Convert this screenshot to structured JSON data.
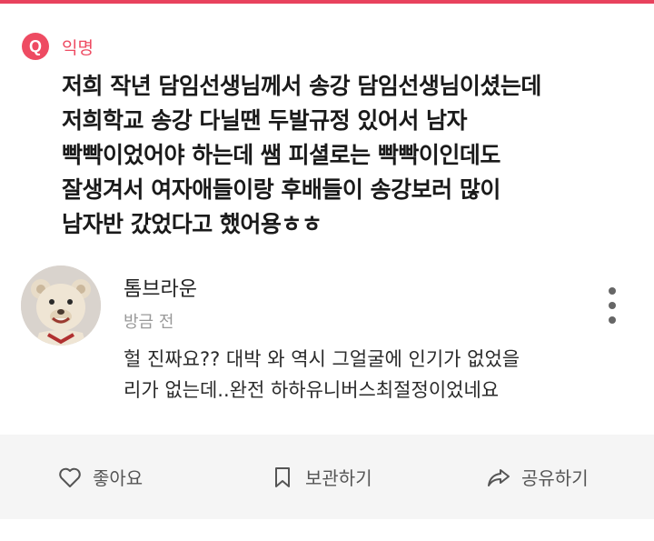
{
  "post": {
    "badge_letter": "Q",
    "author": "익명",
    "body_lines": [
      "저희 작년 담임선생님께서 송강 담임선생님이셨는데",
      "저희학교 송강 다닐땐 두발규정 있어서 남자",
      "빡빡이었어야 하는데 쌤 피셜로는 빡빡이인데도",
      "잘생겨서 여자애들이랑 후배들이 송강보러 많이",
      "남자반 갔었다고 했어용ㅎㅎ"
    ]
  },
  "comment": {
    "author": "톰브라운",
    "time": "방금 전",
    "text_lines": [
      "헐 진짜요?? 대박 와 역시 그얼굴에 인기가 없었을",
      "리가 없는데..완전 하하유니버스최절정이었네요"
    ]
  },
  "actions": {
    "like": "좋아요",
    "save": "보관하기",
    "share": "공유하기"
  },
  "colors": {
    "accent": "#ee4b62",
    "action_bar_bg": "#f5f5f5"
  }
}
